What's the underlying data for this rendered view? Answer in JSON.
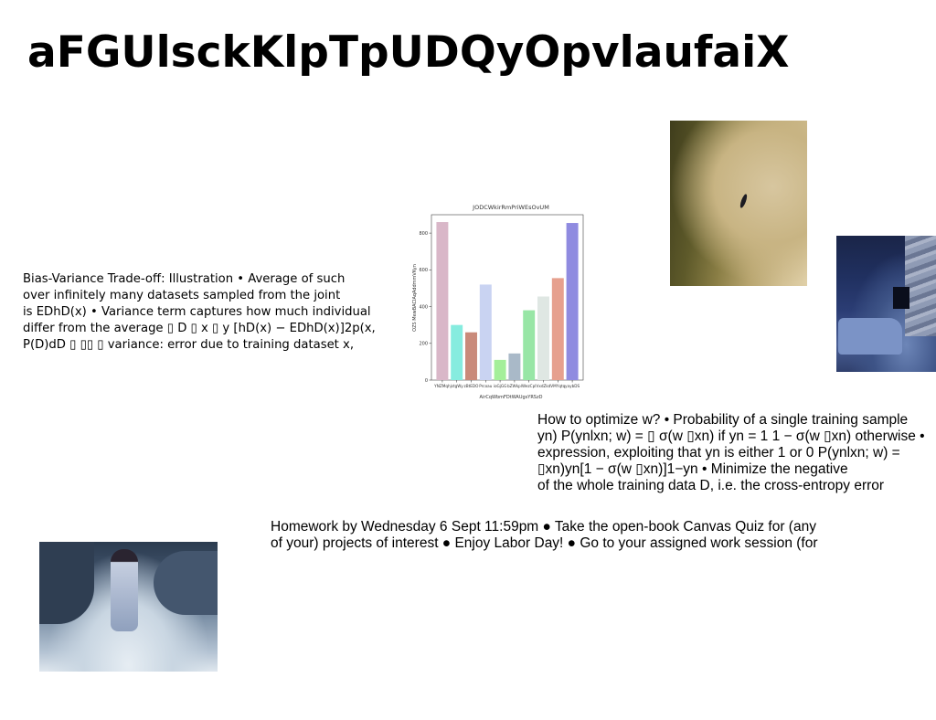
{
  "slide": {
    "title": "aFGUlsckKlpTpUDQyOpvlaufaiX",
    "text_left_lines": [
      "Bias-Variance Trade-off: Illustration • Average of such",
      "over infinitely many datasets sampled from the joint",
      "is EDhD(x) • Variance term captures how much individual",
      "differ from the average ▯ D ▯ x ▯ y [hD(x) − EDhD(x)]2p(x,",
      "P(D)dD ▯ ▯▯ ▯ variance: error due to training dataset x,"
    ],
    "text_right_lines": [
      "How to optimize w? • Probability of a single training sample",
      "yn) P(ynlxn; w) = ▯ σ(w ▯xn) if yn = 1 1 − σ(w ▯xn) otherwise •",
      "expression, exploiting that yn is either 1 or 0 P(ynlxn; w) =",
      "▯xn)yn[1 − σ(w ▯xn)]1−yn • Minimize the negative",
      "of the whole training data D, i.e. the cross-entropy error"
    ],
    "text_bottom_lines": [
      "Homework by Wednesday 6 Sept 11:59pm ● Take the open-book Canvas Quiz for (any",
      "of your) projects of interest ● Enjoy Labor Day! ● Go to your assigned work session (for"
    ]
  },
  "chart_data": {
    "type": "bar",
    "title": "JODCWkirRmPriWEsOvUM",
    "xlabel": "AirCqWbmFDtWAUgsYRSzD",
    "ylabel": "OZS MewBACIAqAddmmVKyn",
    "ylim": [
      0,
      900
    ],
    "yticks": [
      0,
      200,
      400,
      600,
      800
    ],
    "categories": [
      "YNZMqh",
      "jstgWy",
      "zBtEDO",
      "Prcoau",
      "ioGjGG",
      "bZWkpl",
      "WezCpl",
      "VxdZkd",
      "VMYqtq",
      "yaybDS"
    ],
    "values": [
      860,
      300,
      260,
      520,
      110,
      145,
      380,
      455,
      555,
      855
    ],
    "colors": [
      "#d9b7c8",
      "#86ecdf",
      "#c98a7a",
      "#c9d3f2",
      "#a4ef9a",
      "#a9b9c8",
      "#98e6a6",
      "#dfe7e3",
      "#e6a08e",
      "#8f8be0"
    ]
  }
}
